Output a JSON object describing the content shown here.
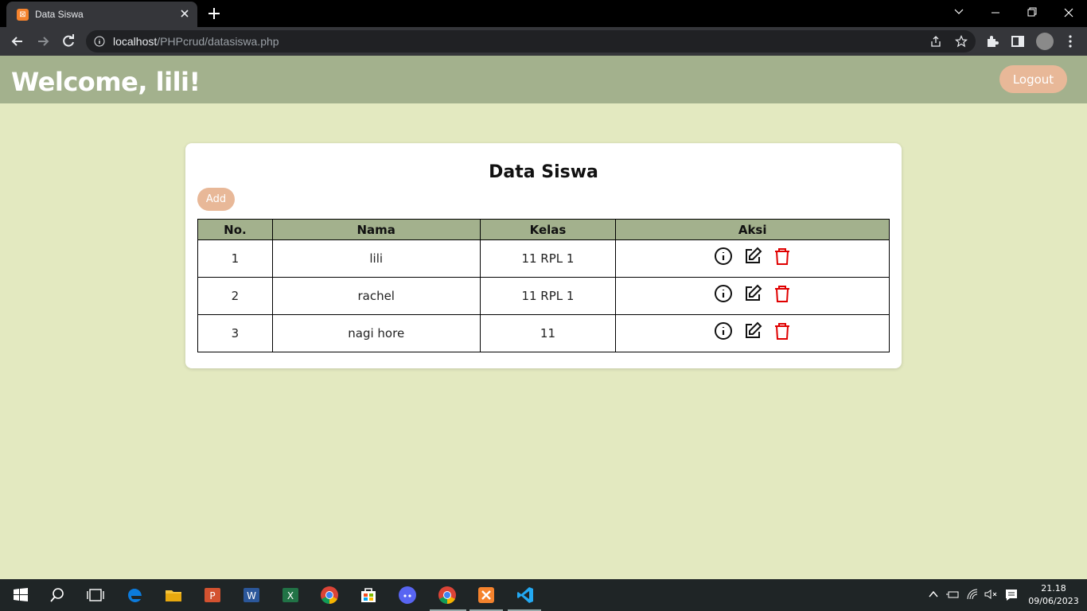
{
  "browser": {
    "tab_title": "Data Siswa",
    "url_host": "localhost",
    "url_path": "/PHPcrud/datasiswa.php"
  },
  "header": {
    "welcome": "Welcome, lili!",
    "logout_label": "Logout"
  },
  "card": {
    "title": "Data Siswa",
    "add_label": "Add"
  },
  "table": {
    "columns": [
      "No.",
      "Nama",
      "Kelas",
      "Aksi"
    ],
    "rows": [
      {
        "no": "1",
        "nama": "lili",
        "kelas": "11 RPL 1"
      },
      {
        "no": "2",
        "nama": "rachel",
        "kelas": "11 RPL 1"
      },
      {
        "no": "3",
        "nama": "nagi hore",
        "kelas": "11"
      }
    ]
  },
  "taskbar": {
    "time": "21.18",
    "date": "09/06/2023"
  },
  "colors": {
    "header_bg": "#a3b18d",
    "page_bg": "#e3e9c0",
    "button_bg": "#e8b898",
    "delete_icon": "#e00000"
  }
}
